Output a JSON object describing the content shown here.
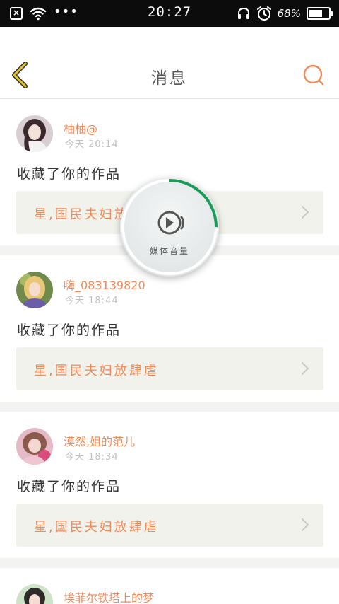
{
  "status_bar": {
    "time": "20:27",
    "battery_percent_text": "68%",
    "battery_level": 0.68,
    "dots": "•••"
  },
  "header": {
    "title": "消息",
    "accent_color": "#f08a57",
    "back_color": "#e0c32c"
  },
  "messages": [
    {
      "username": "柚柚@",
      "timestamp": "今天 20:14",
      "action": "收藏了你的作品",
      "work_title": "星,国民夫妇放肆虐",
      "avatar_icon": "avatar-girl-dark-hair"
    },
    {
      "username": "嗨_083139820",
      "timestamp": "今天 18:44",
      "action": "收藏了你的作品",
      "work_title": "星,国民夫妇放肆虐",
      "avatar_icon": "avatar-girl-blonde"
    },
    {
      "username": "漠然,姐的范儿",
      "timestamp": "今天 18:34",
      "action": "收藏了你的作品",
      "work_title": "星,国民夫妇放肆虐",
      "avatar_icon": "avatar-girl-pink"
    },
    {
      "username": "埃菲尔铁塔上的梦",
      "timestamp": "",
      "action": "",
      "work_title": "",
      "avatar_icon": "avatar-girl-green"
    }
  ],
  "media_overlay": {
    "label": "媒体音量",
    "volume_level": 0.25,
    "ring_color": "#1a9b57"
  }
}
